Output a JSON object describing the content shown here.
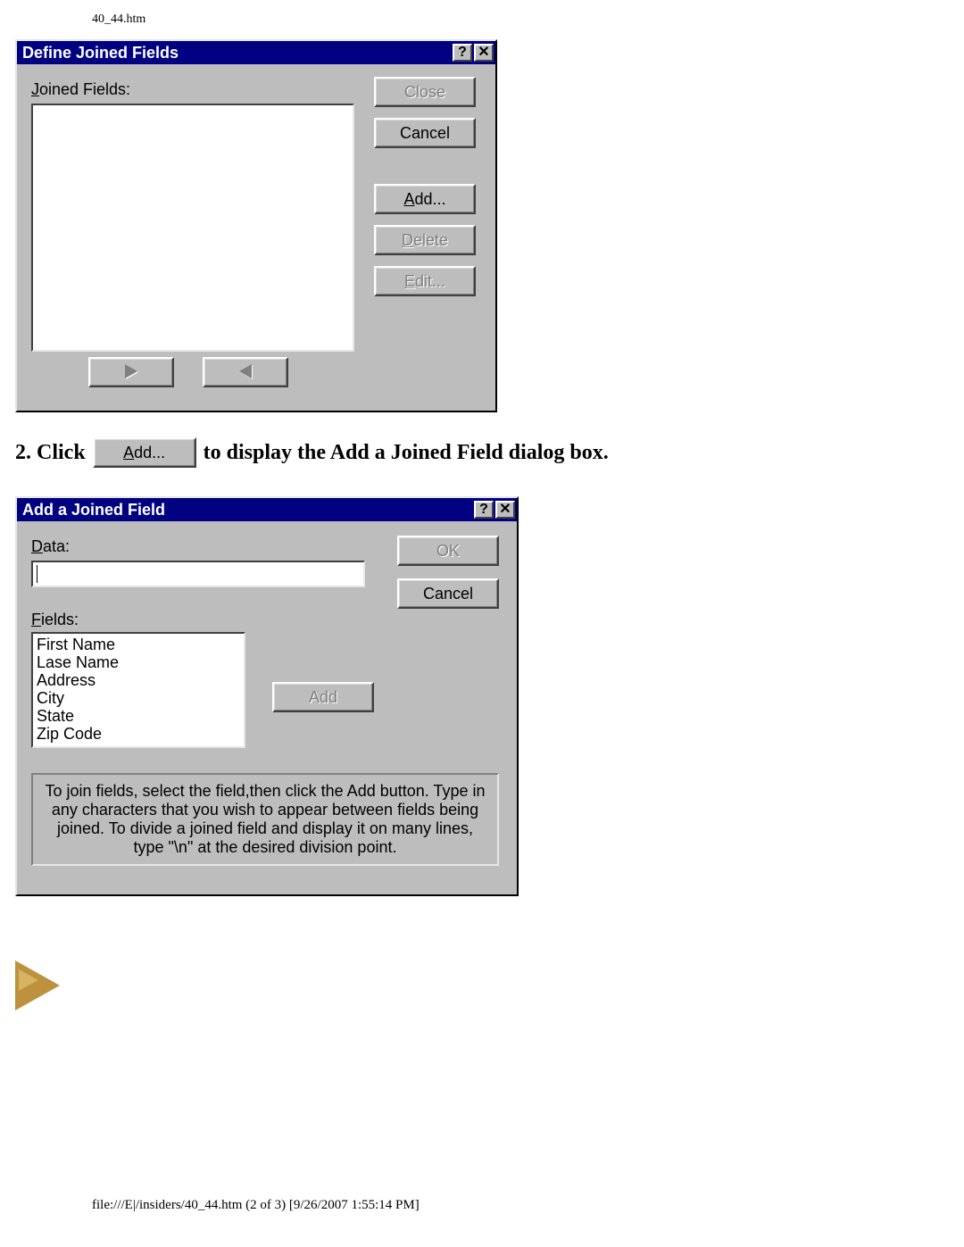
{
  "page": {
    "header": "40_44.htm",
    "footer": "file:///E|/insiders/40_44.htm (2 of 3) [9/26/2007 1:55:14 PM]"
  },
  "dlg1": {
    "title": "Define Joined Fields",
    "help_glyph": "?",
    "close_glyph": "✕",
    "joined_label_pre": "J",
    "joined_label_rest": "oined Fields:",
    "buttons": {
      "close": "Close",
      "cancel": "Cancel",
      "add_pre": "A",
      "add_rest": "dd...",
      "delete_pre": "D",
      "delete_rest": "elete",
      "edit_pre": "E",
      "edit_rest": "dit..."
    }
  },
  "instruction": {
    "step": "2. Click",
    "btn_pre": "A",
    "btn_rest": "dd...",
    "rest": " to display the Add a Joined Field dialog box."
  },
  "dlg2": {
    "title": "Add a Joined Field",
    "help_glyph": "?",
    "close_glyph": "✕",
    "data_pre": "D",
    "data_rest": "ata:",
    "fields_pre": "F",
    "fields_rest": "ields:",
    "fields_list": [
      "First Name",
      "Lase Name",
      "Address",
      "City",
      "State",
      "Zip Code"
    ],
    "buttons": {
      "ok": "OK",
      "cancel": "Cancel",
      "add": "Add"
    },
    "helptext": "To join fields, select the field,then click the Add button. Type in any characters that you wish to appear between fields being joined.  To divide a joined field and display it on many lines, type \"\\n\" at the desired division point."
  }
}
